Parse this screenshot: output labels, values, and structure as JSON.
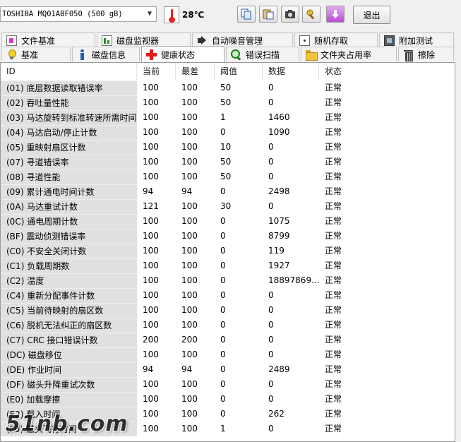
{
  "toolbar": {
    "drive_label": "TOSHIBA MQ01ABF050 (500 gB)",
    "temperature": "28℃",
    "exit_label": "退出",
    "buttons": [
      "copy-icon",
      "paste-icon",
      "camera-icon",
      "wrench-icon",
      "download-arrow-icon"
    ]
  },
  "tabs_row1": [
    {
      "label": "文件基准",
      "icon": "document-icon"
    },
    {
      "label": "磁盘监视器",
      "icon": "chart-icon"
    },
    {
      "label": "自动噪音管理",
      "icon": "speaker-icon"
    },
    {
      "label": "随机存取",
      "icon": "dice-icon"
    },
    {
      "label": "附加测试",
      "icon": "chip-icon"
    }
  ],
  "tabs_row2": [
    {
      "label": "基准",
      "icon": "bulb-icon"
    },
    {
      "label": "磁盘信息",
      "icon": "info-icon"
    },
    {
      "label": "健康状态",
      "icon": "health-cross-icon",
      "active": true
    },
    {
      "label": "错误扫描",
      "icon": "magnifier-icon"
    },
    {
      "label": "文件夹占用率",
      "icon": "folder-icon"
    },
    {
      "label": "擦除",
      "icon": "trash-icon"
    }
  ],
  "columns": {
    "id": "ID",
    "current": "当前",
    "worst": "最差",
    "threshold": "阈值",
    "data": "数据",
    "status": "状态"
  },
  "rows": [
    {
      "id": "(01) 底层数据读取错误率",
      "current": "100",
      "worst": "100",
      "threshold": "50",
      "data": "0",
      "status": "正常"
    },
    {
      "id": "(02) 吞吐量性能",
      "current": "100",
      "worst": "100",
      "threshold": "50",
      "data": "0",
      "status": "正常"
    },
    {
      "id": "(03) 马达旋转到标准转速所需时间",
      "current": "100",
      "worst": "100",
      "threshold": "1",
      "data": "1460",
      "status": "正常"
    },
    {
      "id": "(04) 马达启动/停止计数",
      "current": "100",
      "worst": "100",
      "threshold": "0",
      "data": "1090",
      "status": "正常"
    },
    {
      "id": "(05) 重映射扇区计数",
      "current": "100",
      "worst": "100",
      "threshold": "10",
      "data": "0",
      "status": "正常"
    },
    {
      "id": "(07) 寻道错误率",
      "current": "100",
      "worst": "100",
      "threshold": "50",
      "data": "0",
      "status": "正常"
    },
    {
      "id": "(08) 寻道性能",
      "current": "100",
      "worst": "100",
      "threshold": "50",
      "data": "0",
      "status": "正常"
    },
    {
      "id": "(09) 累计通电时间计数",
      "current": "94",
      "worst": "94",
      "threshold": "0",
      "data": "2498",
      "status": "正常"
    },
    {
      "id": "(0A) 马达重试计数",
      "current": "121",
      "worst": "100",
      "threshold": "30",
      "data": "0",
      "status": "正常"
    },
    {
      "id": "(0C) 通电周期计数",
      "current": "100",
      "worst": "100",
      "threshold": "0",
      "data": "1075",
      "status": "正常"
    },
    {
      "id": "(BF) 震动侦测错误率",
      "current": "100",
      "worst": "100",
      "threshold": "0",
      "data": "8799",
      "status": "正常"
    },
    {
      "id": "(C0) 不安全关闭计数",
      "current": "100",
      "worst": "100",
      "threshold": "0",
      "data": "119",
      "status": "正常"
    },
    {
      "id": "(C1) 负载周期数",
      "current": "100",
      "worst": "100",
      "threshold": "0",
      "data": "1927",
      "status": "正常"
    },
    {
      "id": "(C2) 温度",
      "current": "100",
      "worst": "100",
      "threshold": "0",
      "data": "18897869...",
      "status": "正常"
    },
    {
      "id": "(C4) 重新分配事件计数",
      "current": "100",
      "worst": "100",
      "threshold": "0",
      "data": "0",
      "status": "正常"
    },
    {
      "id": "(C5) 当前待映射的扇区数",
      "current": "100",
      "worst": "100",
      "threshold": "0",
      "data": "0",
      "status": "正常"
    },
    {
      "id": "(C6) 脱机无法纠正的扇区数",
      "current": "100",
      "worst": "100",
      "threshold": "0",
      "data": "0",
      "status": "正常"
    },
    {
      "id": "(C7) CRC 接口错误计数",
      "current": "200",
      "worst": "200",
      "threshold": "0",
      "data": "0",
      "status": "正常"
    },
    {
      "id": "(DC) 磁盘移位",
      "current": "100",
      "worst": "100",
      "threshold": "0",
      "data": "0",
      "status": "正常"
    },
    {
      "id": "(DE) 作业时间",
      "current": "94",
      "worst": "94",
      "threshold": "0",
      "data": "2489",
      "status": "正常"
    },
    {
      "id": "(DF) 磁头升降重试次数",
      "current": "100",
      "worst": "100",
      "threshold": "0",
      "data": "0",
      "status": "正常"
    },
    {
      "id": "(E0) 加载摩擦",
      "current": "100",
      "worst": "100",
      "threshold": "0",
      "data": "0",
      "status": "正常"
    },
    {
      "id": "(E2) 载入时间",
      "current": "100",
      "worst": "100",
      "threshold": "0",
      "data": "262",
      "status": "正常"
    },
    {
      "id": "(F0) 磁头飞行时间",
      "current": "100",
      "worst": "100",
      "threshold": "1",
      "data": "0",
      "status": "正常"
    }
  ],
  "watermark": "51nb.com"
}
